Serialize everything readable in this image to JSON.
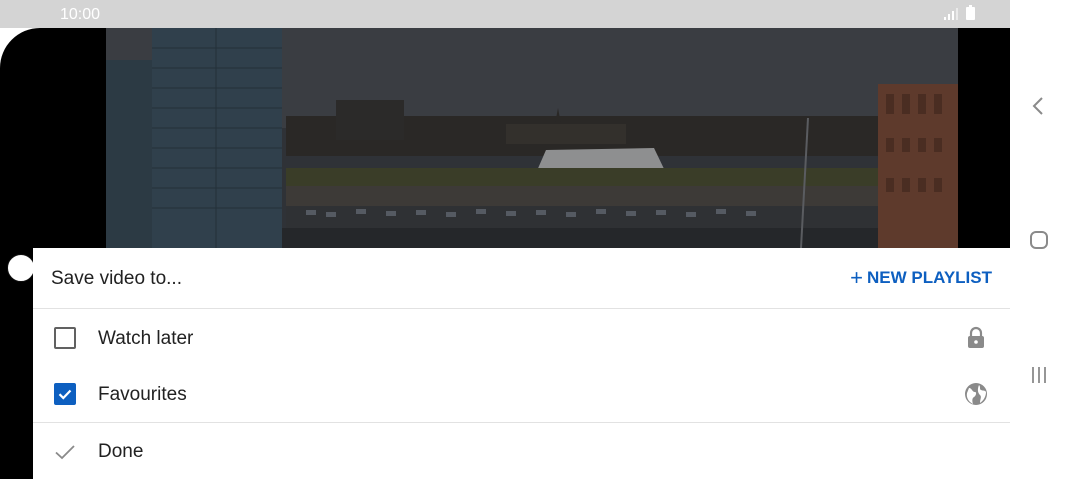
{
  "status_bar": {
    "time": "10:00",
    "icons": [
      "signal-icon",
      "battery-icon"
    ]
  },
  "sheet": {
    "title": "Save video to...",
    "new_playlist_label": "NEW PLAYLIST",
    "new_playlist_icon": "plus-icon",
    "accent_color": "#0d5fc0",
    "playlists": [
      {
        "label": "Watch later",
        "checked": false,
        "privacy_icon": "lock-icon"
      },
      {
        "label": "Favourites",
        "checked": true,
        "privacy_icon": "globe-icon"
      }
    ],
    "done_label": "Done",
    "done_icon": "checkmark-icon"
  },
  "navigation": {
    "icons": [
      "back-icon",
      "home-icon",
      "recents-icon"
    ]
  }
}
